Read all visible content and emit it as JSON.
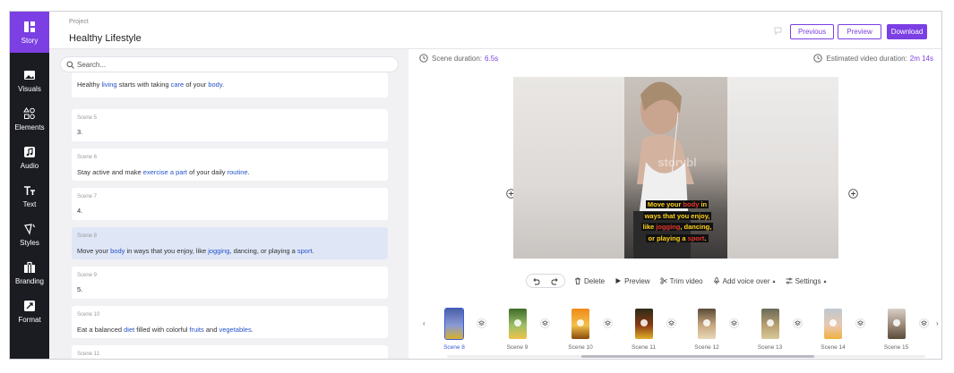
{
  "rail": [
    {
      "label": "Story",
      "icon": "story-icon"
    },
    {
      "label": "Visuals",
      "icon": "image-icon"
    },
    {
      "label": "Elements",
      "icon": "shapes-icon"
    },
    {
      "label": "Audio",
      "icon": "music-icon"
    },
    {
      "label": "Text",
      "icon": "text-icon"
    },
    {
      "label": "Styles",
      "icon": "paint-icon"
    },
    {
      "label": "Branding",
      "icon": "briefcase-icon"
    },
    {
      "label": "Format",
      "icon": "resize-icon"
    }
  ],
  "header": {
    "project_label": "Project",
    "project_name": "Healthy Lifestyle",
    "previous_label": "Previous",
    "preview_label": "Preview",
    "download_label": "Download"
  },
  "search": {
    "placeholder": "Search..."
  },
  "scenes": {
    "partial_top": {
      "before1": "Healthy ",
      "kw1": "living",
      "mid1": " starts with taking ",
      "kw2": "care",
      "mid2": " of your ",
      "kw3": "body",
      "end": "."
    },
    "s5": {
      "label": "Scene 5",
      "text": "3."
    },
    "s6": {
      "label": "Scene 6",
      "t1": "Stay active and make ",
      "k1": "exercise",
      "t2": " ",
      "k2": "a part",
      "t3": " of your daily ",
      "k3": "routine",
      "t4": "."
    },
    "s7": {
      "label": "Scene 7",
      "text": "4."
    },
    "s8": {
      "label": "Scene 8",
      "t1": "Move your ",
      "k1": "body",
      "t2": " in ways that you enjoy, like ",
      "k2": "jogging",
      "t3": ", dancing, or playing a ",
      "k3": "sport",
      "t4": "."
    },
    "s9": {
      "label": "Scene 9",
      "text": "5."
    },
    "s10": {
      "label": "Scene 10",
      "t1": "Eat a balanced ",
      "k1": "diet",
      "t2": " filled with colorful ",
      "k2": "fruits",
      "t3": " and ",
      "k3": "vegetables",
      "t4": "."
    },
    "s11": {
      "label": "Scene 11"
    }
  },
  "preview": {
    "scene_duration_label": "Scene duration:",
    "scene_duration_value": "6.5s",
    "estimated_label": "Estimated video duration:",
    "estimated_value": "2m 14s",
    "watermark": "storybl",
    "caption": {
      "l1a": "Move your ",
      "l1b": "body",
      "l1c": " in",
      "l2": "ways that you enjoy,",
      "l3a": "like ",
      "l3b": "jogging",
      "l3c": ", dancing,",
      "l4a": "or playing a ",
      "l4b": "sport",
      "l4c": "."
    }
  },
  "toolbar": {
    "delete": "Delete",
    "preview": "Preview",
    "trim": "Trim video",
    "voice": "Add voice over",
    "settings": "Settings"
  },
  "timeline": {
    "labels": [
      "Scene 8",
      "Scene 9",
      "Scene 10",
      "Scene 11",
      "Scene 12",
      "Scene 13",
      "Scene 14",
      "Scene 15"
    ],
    "selected_index": 0,
    "prev_arrow": "‹",
    "next_arrow": "›"
  },
  "colors": {
    "accent": "#7b3fe4",
    "keyword": "#2453c9",
    "caption_yellow": "#ffd21a",
    "caption_red": "#e6362c"
  }
}
